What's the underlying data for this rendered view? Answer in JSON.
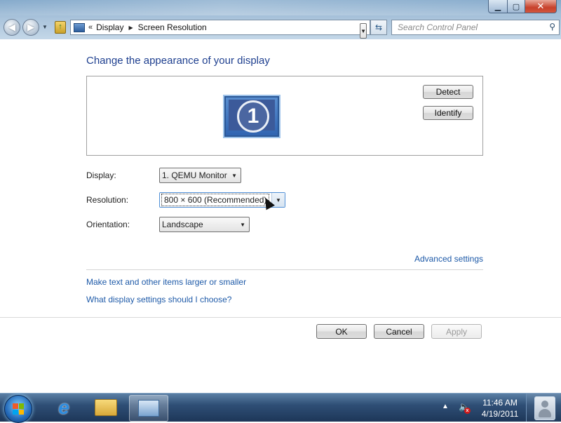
{
  "window": {
    "minimize_glyph": "▁",
    "maximize_glyph": "▢",
    "close_glyph": "✕"
  },
  "navbar": {
    "back_glyph": "◀",
    "forward_glyph": "▶",
    "address_separator": "«",
    "breadcrumb": [
      "Display",
      "Screen Resolution"
    ],
    "search_placeholder": "Search Control Panel",
    "icons": [
      "back-icon",
      "forward-icon",
      "up-folder-icon",
      "control-panel-icon",
      "refresh-icon",
      "search-icon"
    ]
  },
  "main": {
    "heading": "Change the appearance of your display",
    "detect_label": "Detect",
    "identify_label": "Identify",
    "monitor_number": "1",
    "display_label": "Display:",
    "display_value": "1. QEMU Monitor",
    "resolution_label": "Resolution:",
    "resolution_value": "800 × 600 (Recommended)",
    "orientation_label": "Orientation:",
    "orientation_value": "Landscape",
    "advanced_link": "Advanced settings",
    "link_text_size": "Make text and other items larger or smaller",
    "link_what_settings": "What display settings should I choose?",
    "ok_label": "OK",
    "cancel_label": "Cancel",
    "apply_label": "Apply"
  },
  "taskbar": {
    "items": [
      "start-orb",
      "internet-explorer",
      "windows-explorer",
      "control-panel"
    ],
    "clock_time": "11:46 AM",
    "clock_date": "4/19/2011",
    "volume_muted": true
  },
  "colors": {
    "heading": "#1e3f8f",
    "link": "#1e5aa8",
    "taskbar": "#2f4f76"
  }
}
